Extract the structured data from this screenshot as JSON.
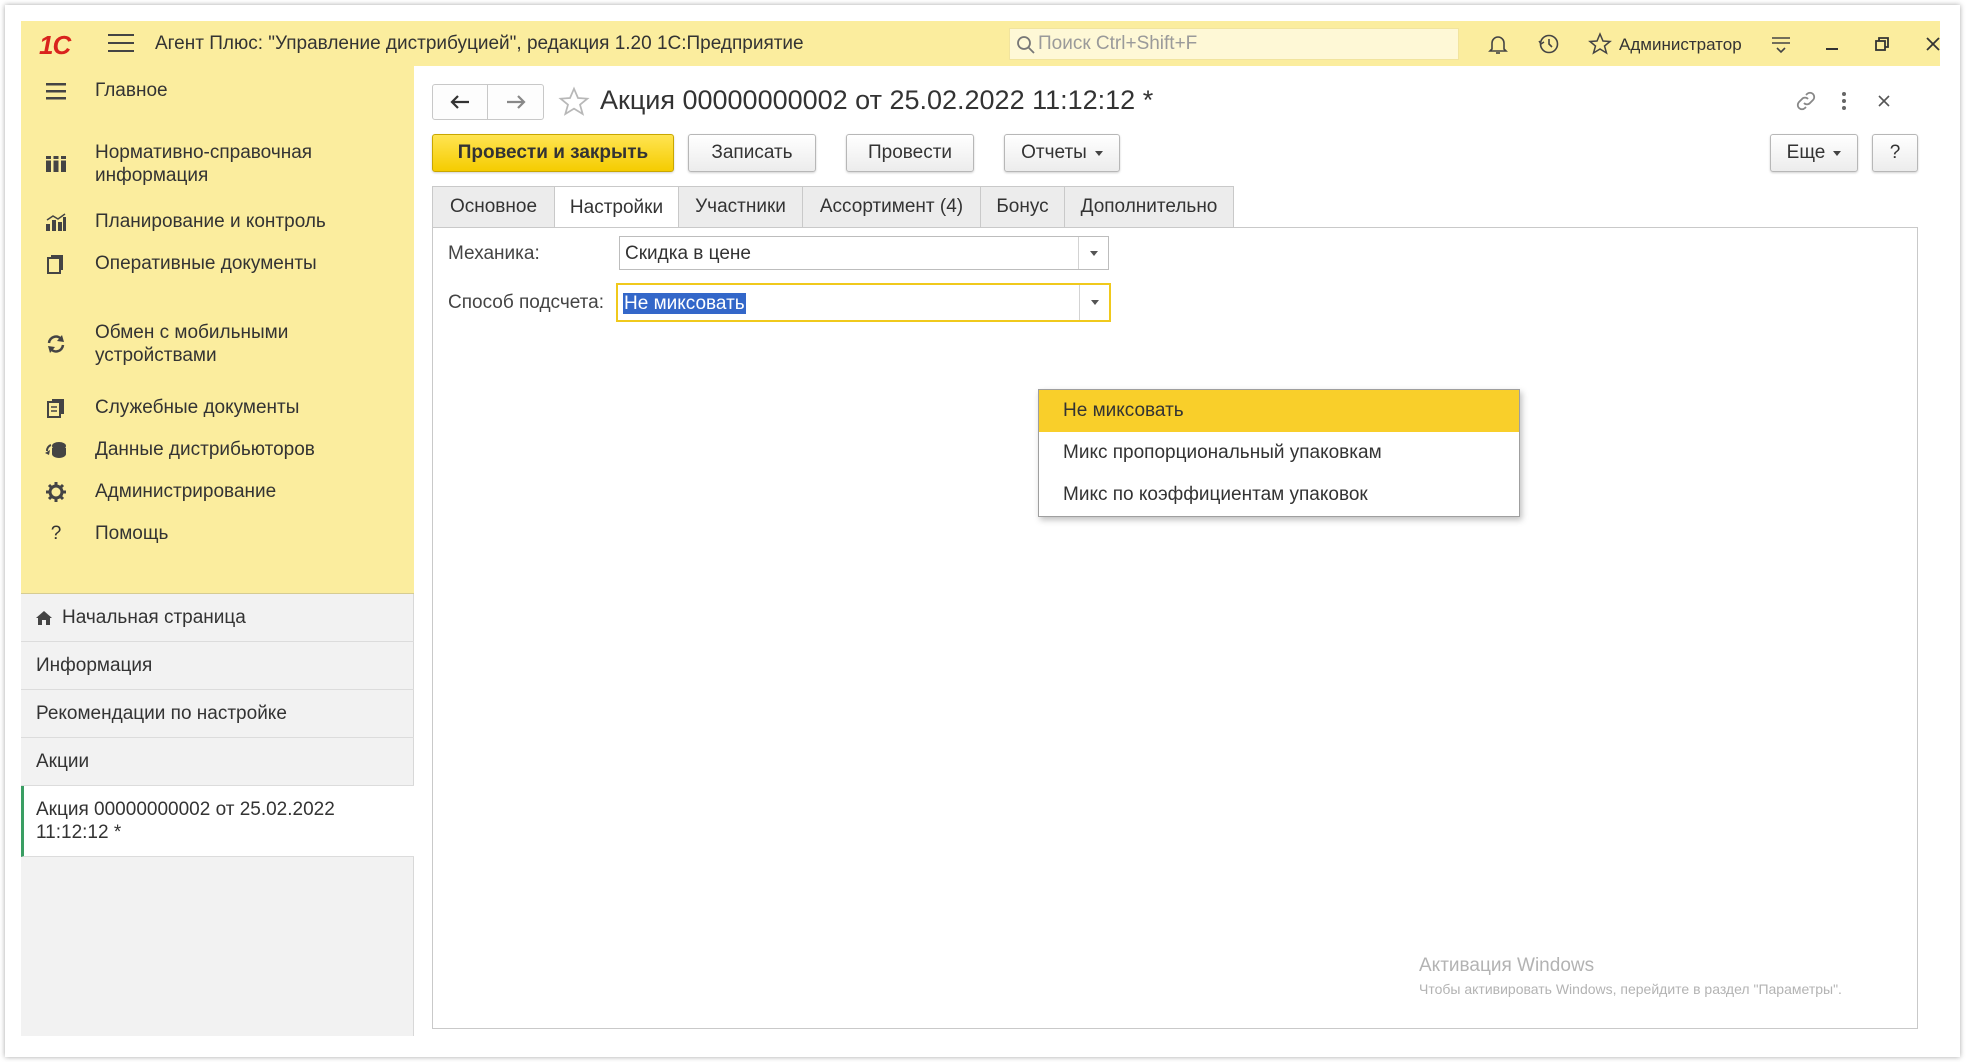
{
  "app": {
    "logo": "1С",
    "title": "Агент Плюс: \"Управление дистрибуцией\", редакция 1.20 1С:Предприятие",
    "search_placeholder": "Поиск Ctrl+Shift+F",
    "user": "Администратор"
  },
  "sidebar": {
    "sections": [
      {
        "label": "Главное",
        "icon": "menu-icon"
      },
      {
        "label": "Нормативно-справочная информация",
        "icon": "catalog-icon"
      },
      {
        "label": "Планирование и контроль",
        "icon": "chart-icon"
      },
      {
        "label": "Оперативные документы",
        "icon": "documents-icon"
      },
      {
        "label": "Обмен с мобильными устройствами",
        "icon": "sync-icon"
      },
      {
        "label": "Служебные документы",
        "icon": "service-docs-icon"
      },
      {
        "label": "Данные дистрибьюторов",
        "icon": "distributors-icon"
      },
      {
        "label": "Администрирование",
        "icon": "gear-icon"
      },
      {
        "label": "Помощь",
        "icon": "help-icon"
      }
    ],
    "nav": [
      {
        "label": "Начальная страница"
      },
      {
        "label": "Информация"
      },
      {
        "label": "Рекомендации по настройке"
      },
      {
        "label": "Акции"
      },
      {
        "label": "Акция 00000000002 от 25.02.2022 11:12:12 *"
      }
    ]
  },
  "document": {
    "title": "Акция 00000000002 от 25.02.2022 11:12:12 *",
    "buttons": {
      "post_close": "Провести и закрыть",
      "save": "Записать",
      "post": "Провести",
      "reports": "Отчеты",
      "more": "Еще",
      "help": "?"
    },
    "tabs": [
      "Основное",
      "Настройки",
      "Участники",
      "Ассортимент (4)",
      "Бонус",
      "Дополнительно"
    ],
    "active_tab": "Настройки",
    "fields": {
      "mechanics_label": "Механика:",
      "mechanics_value": "Скидка в цене",
      "calc_label": "Способ подсчета:",
      "calc_value": "Не миксовать"
    },
    "dropdown_options": [
      "Не миксовать",
      "Микс пропорциональный упаковкам",
      "Микс по коэффициентам упаковок"
    ]
  },
  "watermark": {
    "line1": "Активация Windows",
    "line2": "Чтобы активировать Windows, перейдите в раздел \"Параметры\"."
  },
  "colors": {
    "accent_yellow": "#fbed9e",
    "primary_button": "#f5cc00",
    "highlight": "#f9cf2a",
    "selection": "#3367c9",
    "active_marker": "#3a9e63"
  }
}
